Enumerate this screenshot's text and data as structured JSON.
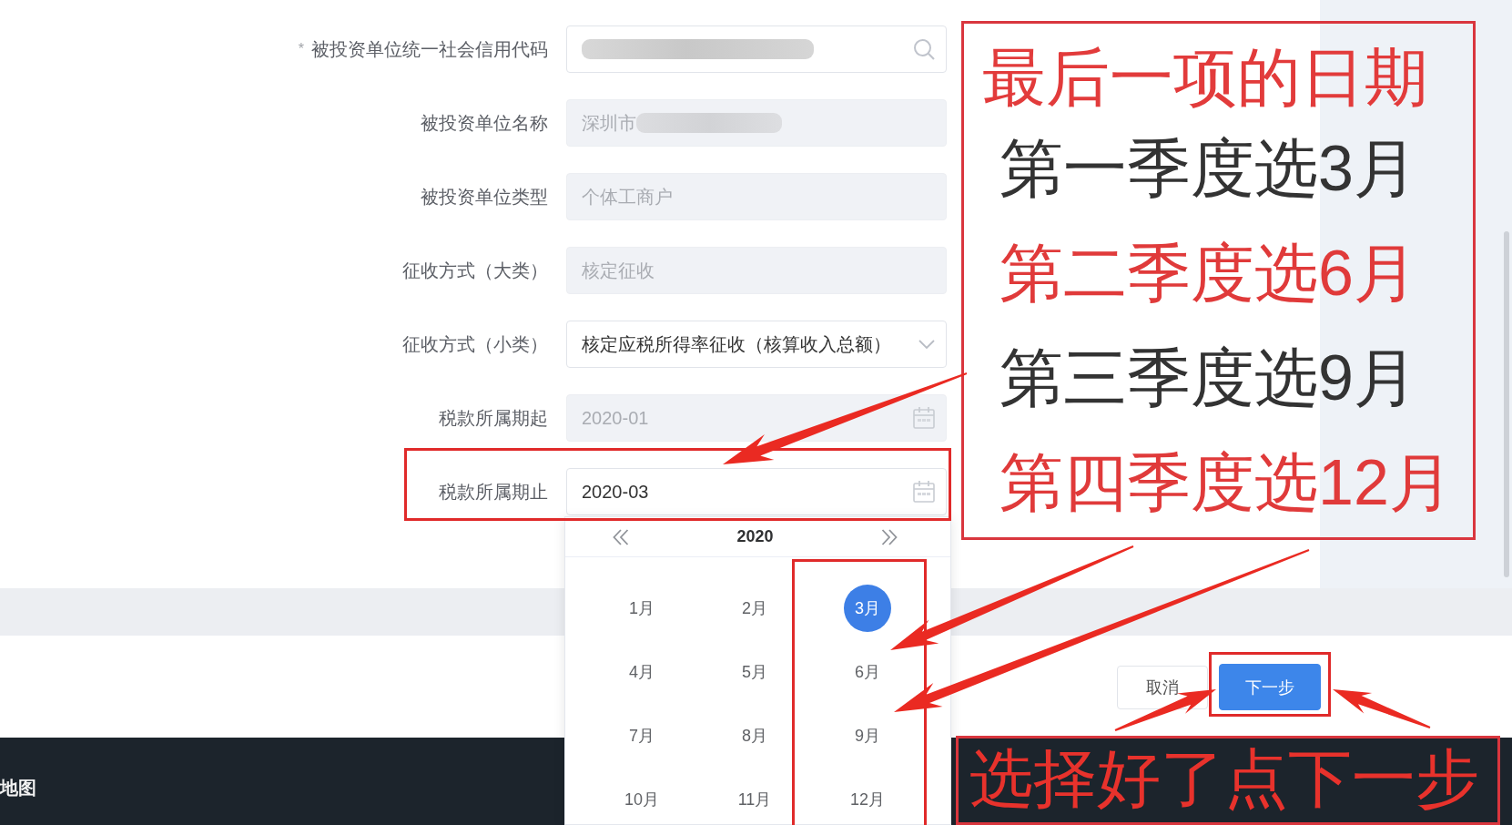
{
  "form": {
    "fields": [
      {
        "label": "被投资单位统一社会信用代码",
        "required_mark": "*",
        "kind": "search",
        "disabled": false,
        "redacted": true,
        "highlighted": false
      },
      {
        "label": "被投资单位名称",
        "kind": "text",
        "value": "深圳市",
        "disabled": true,
        "redacted": true,
        "highlighted": false
      },
      {
        "label": "被投资单位类型",
        "kind": "text",
        "value": "个体工商户",
        "disabled": true,
        "redacted": false,
        "highlighted": false
      },
      {
        "label": "征收方式（大类）",
        "kind": "text",
        "value": "核定征收",
        "disabled": true,
        "redacted": false,
        "highlighted": false
      },
      {
        "label": "征收方式（小类）",
        "kind": "select",
        "value": "核定应税所得率征收（核算收入总额）",
        "disabled": false,
        "redacted": false,
        "highlighted": false
      },
      {
        "label": "税款所属期起",
        "kind": "date",
        "value": "2020-01",
        "disabled": true,
        "redacted": false,
        "highlighted": false
      },
      {
        "label": "税款所属期止",
        "kind": "date",
        "value": "2020-03",
        "disabled": false,
        "redacted": false,
        "highlighted": true
      }
    ]
  },
  "month_picker": {
    "year": "2020",
    "months": [
      {
        "label": "1月",
        "selected": false,
        "highlighted": false
      },
      {
        "label": "2月",
        "selected": false,
        "highlighted": false
      },
      {
        "label": "3月",
        "selected": true,
        "highlighted": true
      },
      {
        "label": "4月",
        "selected": false,
        "highlighted": false
      },
      {
        "label": "5月",
        "selected": false,
        "highlighted": false
      },
      {
        "label": "6月",
        "selected": false,
        "highlighted": true
      },
      {
        "label": "7月",
        "selected": false,
        "highlighted": false
      },
      {
        "label": "8月",
        "selected": false,
        "highlighted": false
      },
      {
        "label": "9月",
        "selected": false,
        "highlighted": true
      },
      {
        "label": "10月",
        "selected": false,
        "highlighted": false
      },
      {
        "label": "11月",
        "selected": false,
        "highlighted": false
      },
      {
        "label": "12月",
        "selected": false,
        "highlighted": true
      }
    ]
  },
  "buttons": [
    {
      "label": "取消",
      "kind": "default",
      "highlighted": false
    },
    {
      "label": "下一步",
      "kind": "primary",
      "highlighted": true
    }
  ],
  "annotation": {
    "title": "最后一项的日期",
    "lines": [
      {
        "text": "第一季度选3月",
        "color": "#333333"
      },
      {
        "text": "第二季度选6月",
        "color": "#e03a3a"
      },
      {
        "text": "第三季度选9月",
        "color": "#333333"
      },
      {
        "text": "第四季度选12月",
        "color": "#e03a3a"
      }
    ],
    "note": "选择好了点下一步"
  },
  "footer": {
    "link": "地图"
  }
}
